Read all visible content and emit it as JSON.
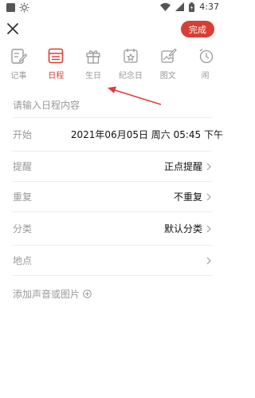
{
  "status_bar": {
    "time": "4:37",
    "icons": [
      "notification-square-icon",
      "brightness-icon",
      "wifi-icon",
      "signal-icon",
      "battery-icon"
    ]
  },
  "header": {
    "done_label": "完成",
    "accent_color": "#d83e36"
  },
  "tabs": [
    {
      "label": "记事",
      "icon": "note-icon",
      "active": false
    },
    {
      "label": "日程",
      "icon": "schedule-icon",
      "active": true
    },
    {
      "label": "生日",
      "icon": "gift-icon",
      "active": false
    },
    {
      "label": "纪念日",
      "icon": "anniversary-icon",
      "active": false
    },
    {
      "label": "图文",
      "icon": "image-text-icon",
      "active": false
    },
    {
      "label": "闹",
      "icon": "alarm-icon",
      "active": false
    }
  ],
  "form": {
    "title_placeholder": "请输入日程内容",
    "start_label": "开始",
    "start_value": "2021年06月05日 周六 05:45 下午",
    "reminder_label": "提醒",
    "reminder_value": "正点提醒",
    "repeat_label": "重复",
    "repeat_value": "不重复",
    "category_label": "分类",
    "category_value": "默认分类",
    "location_label": "地点",
    "add_media_label": "添加声音或图片"
  }
}
